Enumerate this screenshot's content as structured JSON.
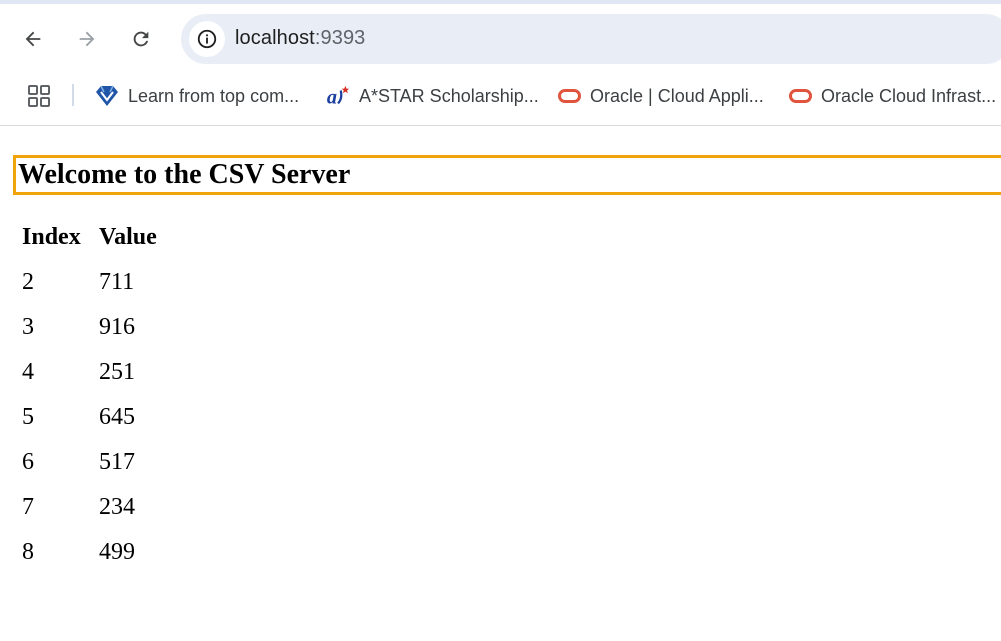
{
  "browser": {
    "url_host": "localhost",
    "url_port": ":9393",
    "bookmarks": [
      {
        "label": "Learn from top com...",
        "icon": "coursera-diamond-icon"
      },
      {
        "label": "A*STAR Scholarship...",
        "icon": "astar-logo-icon"
      },
      {
        "label": "Oracle | Cloud Appli...",
        "icon": "oracle-icon"
      },
      {
        "label": "Oracle Cloud Infrast...",
        "icon": "oracle-icon"
      }
    ]
  },
  "page": {
    "title": "Welcome to the CSV Server",
    "table": {
      "headers": [
        "Index",
        "Value"
      ],
      "rows": [
        [
          "2",
          "711"
        ],
        [
          "3",
          "916"
        ],
        [
          "4",
          "251"
        ],
        [
          "5",
          "645"
        ],
        [
          "6",
          "517"
        ],
        [
          "7",
          "234"
        ],
        [
          "8",
          "499"
        ]
      ]
    }
  },
  "colors": {
    "heading_border": "#f0a30a",
    "omnibox_bg": "#e9eef6",
    "oracle_red": "#e0533d",
    "coursera_blue": "#2155a8"
  }
}
